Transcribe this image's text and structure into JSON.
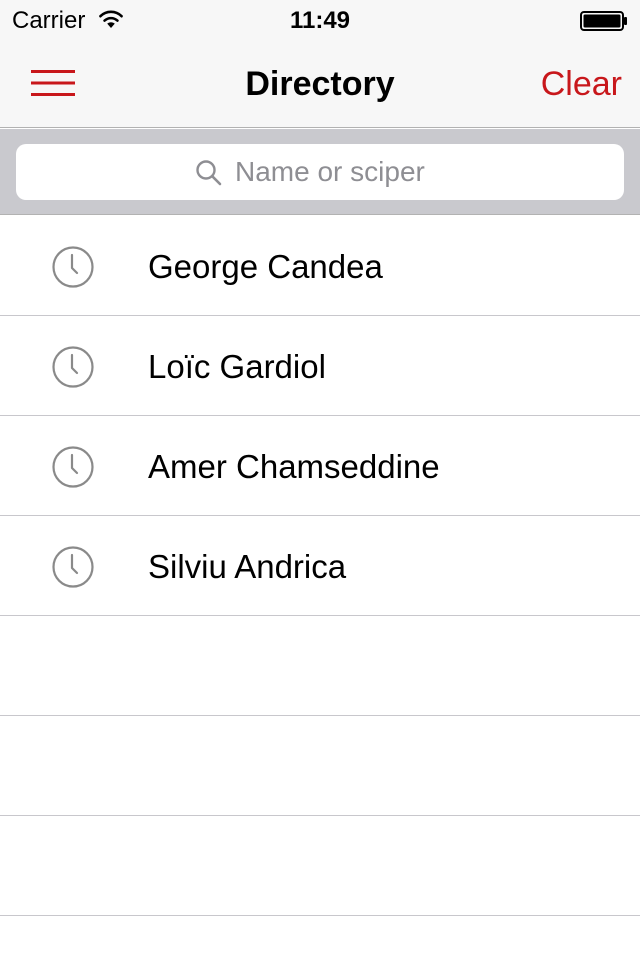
{
  "status_bar": {
    "carrier": "Carrier",
    "time": "11:49"
  },
  "nav_bar": {
    "title": "Directory",
    "clear_label": "Clear",
    "menu_icon": "hamburger-menu-icon",
    "accent_color": "#c8171b"
  },
  "search": {
    "placeholder": "Name or sciper",
    "value": ""
  },
  "recent_searches": [
    {
      "name": "George Candea",
      "icon": "clock-icon"
    },
    {
      "name": "Loïc Gardiol",
      "icon": "clock-icon"
    },
    {
      "name": "Amer Chamseddine",
      "icon": "clock-icon"
    },
    {
      "name": "Silviu Andrica",
      "icon": "clock-icon"
    }
  ]
}
